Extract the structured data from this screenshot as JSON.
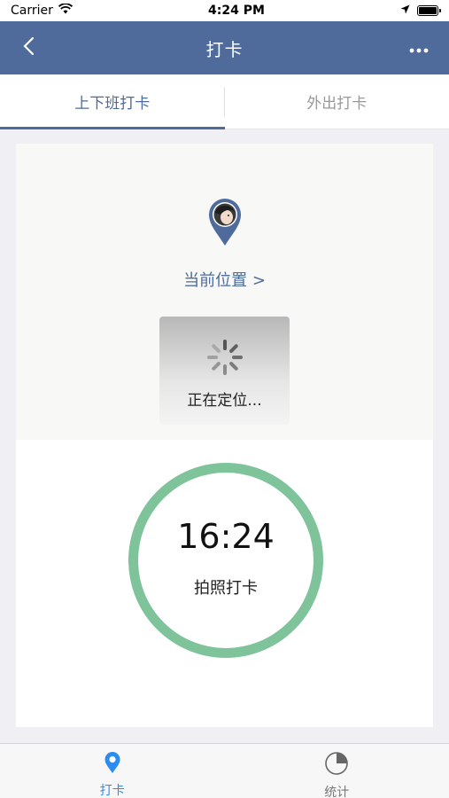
{
  "status_bar": {
    "carrier": "Carrier",
    "time": "4:24 PM"
  },
  "nav": {
    "title": "打卡",
    "back_icon": "chevron-left-icon",
    "more_icon": "more-dots-icon",
    "bar_color": "#4e6b9c"
  },
  "tabs": [
    {
      "label": "上下班打卡",
      "active": true
    },
    {
      "label": "外出打卡",
      "active": false
    }
  ],
  "location": {
    "link_label": "当前位置 >",
    "loading_text": "正在定位..."
  },
  "clock": {
    "time": "16:24",
    "action_label": "拍照打卡",
    "ring_color": "#7fc39a"
  },
  "bottom_tabs": [
    {
      "label": "打卡",
      "icon": "location-pin-icon",
      "active": true
    },
    {
      "label": "统计",
      "icon": "pie-chart-icon",
      "active": false
    }
  ],
  "colors": {
    "accent": "#4e6b9c",
    "bottom_active": "#2d8cf0"
  }
}
